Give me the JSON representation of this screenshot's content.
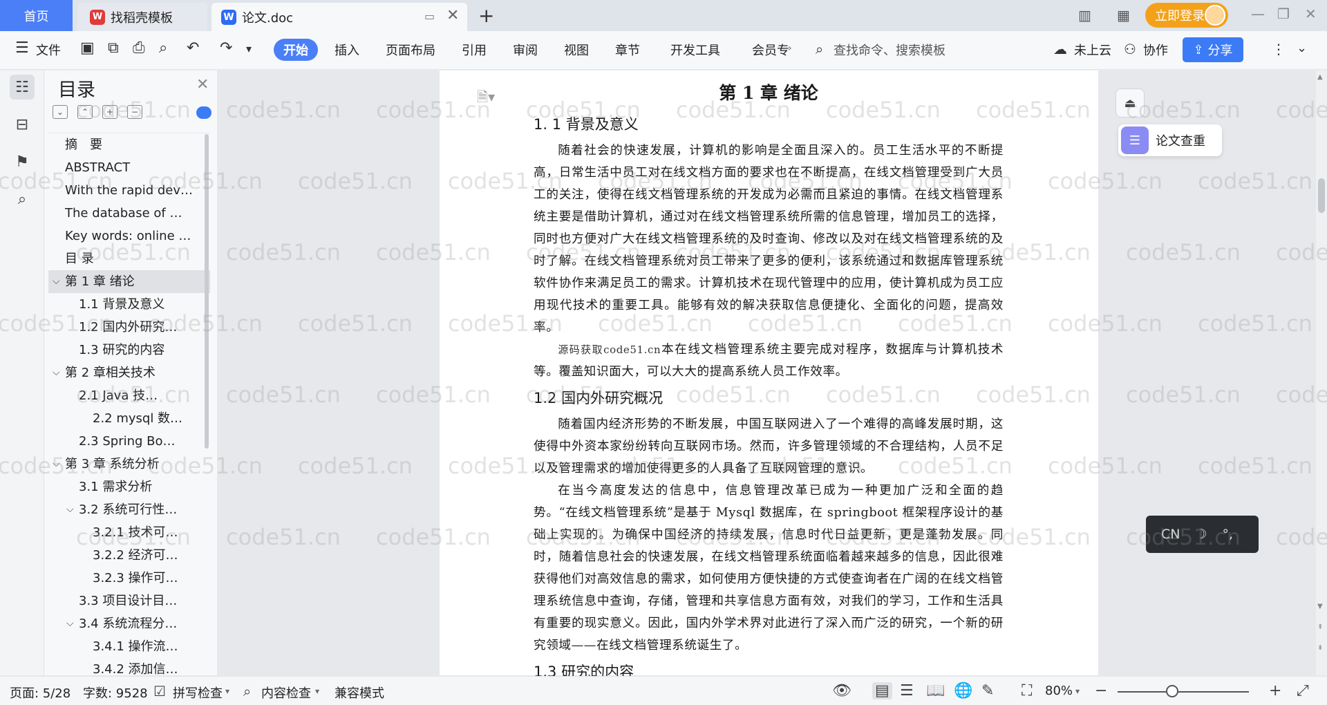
{
  "tabs": {
    "home": "首页",
    "template": "找稻壳模板",
    "document": "论文.doc"
  },
  "titlebar": {
    "login": "立即登录"
  },
  "ribbon": {
    "file": "文件",
    "tabs": [
      "开始",
      "插入",
      "页面布局",
      "引用",
      "审阅",
      "视图",
      "章节",
      "开发工具",
      "会员专"
    ],
    "search_placeholder": "查找命令、搜索模板",
    "cloud": "未上云",
    "collab": "协作",
    "share": "分享"
  },
  "toc": {
    "title": "目录",
    "items": [
      {
        "label": "摘　要",
        "level": 1
      },
      {
        "label": "ABSTRACT",
        "level": 1
      },
      {
        "label": "With the rapid dev…",
        "level": 1
      },
      {
        "label": "The database of …",
        "level": 1
      },
      {
        "label": "Key words: online …",
        "level": 1
      },
      {
        "label": "目  录",
        "level": 1
      },
      {
        "label": "第 1 章  绪论",
        "level": 1
      },
      {
        "label": "1.1 背景及意义",
        "level": 2
      },
      {
        "label": "1.2  国内外研究…",
        "level": 2
      },
      {
        "label": "1.3  研究的内容",
        "level": 2
      },
      {
        "label": "第 2 章相关技术",
        "level": 1
      },
      {
        "label": "2.1    Java 技…",
        "level": 2
      },
      {
        "label": "2.2 mysql 数…",
        "level": 3
      },
      {
        "label": "2.3 Spring    Bo…",
        "level": 2
      },
      {
        "label": "第 3 章  系统分析",
        "level": 1
      },
      {
        "label": "3.1  需求分析",
        "level": 2
      },
      {
        "label": "3.2  系统可行性…",
        "level": 2
      },
      {
        "label": "3.2.1 技术可…",
        "level": 3
      },
      {
        "label": "3.2.2 经济可…",
        "level": 3
      },
      {
        "label": "3.2.3 操作可…",
        "level": 3
      },
      {
        "label": "3.3  项目设计目…",
        "level": 2
      },
      {
        "label": "3.4 系统流程分…",
        "level": 2
      },
      {
        "label": "3.4.1 操作流…",
        "level": 3
      },
      {
        "label": "3.4.2 添加信…",
        "level": 3
      }
    ]
  },
  "document": {
    "chapter_title": "第 1 章  绪论",
    "h_1_1": "1. 1 背景及意义",
    "p1": "随着社会的快速发展，计算机的影响是全面且深入的。员工生活水平的不断提高，日常生活中员工对在线文档方面的要求也在不断提高，在线文档管理受到广大员工的关注，使得在线文档管理系统的开发成为必需而且紧迫的事情。在线文档管理系统主要是借助计算机，通过对在线文档管理系统所需的信息管理，增加员工的选择，同时也方便对广大在线文档管理系统的及时查询、修改以及对在线文档管理系统的及时了解。在线文档管理系统对员工带来了更多的便利，该系统通过和数据库管理系统软件协作来满足员工的需求。计算机技术在现代管理中的应用，使计算机成为员工应用现代技术的重要工具。能够有效的解决获取信息便捷化、全面化的问题，提高效率。",
    "p2_overlay": "源码获取code51.cn",
    "p2": "本在线文档管理系统主要完成对程序，数据库与计算机技术等。覆盖知识面大，可以大大的提高系统人员工作效率。",
    "h_1_2": "1.2  国内外研究概况",
    "p3": "随着国内经济形势的不断发展，中国互联网进入了一个难得的高峰发展时期，这使得中外资本家纷纷转向互联网市场。然而，许多管理领域的不合理结构，人员不足以及管理需求的增加使得更多的人具备了互联网管理的意识。",
    "p4": "在当今高度发达的信息中，信息管理改革已成为一种更加广泛和全面的趋势。“在线文档管理系统”是基于 Mysql 数据库，在 springboot 框架程序设计的基础上实现的。为确保中国经济的持续发展，信息时代日益更新，更是蓬勃发展。同时，随着信息社会的快速发展，在线文档管理系统面临着越来越多的信息，因此很难获得他们对高效信息的需求，如何使用方便快捷的方式使查询者在广阔的在线文档管理系统信息中查询，存储，管理和共享信息方面有效，对我们的学习，工作和生活具有重要的现实意义。因此，国内外学术界对此进行了深入而广泛的研究，一个新的研究领域——在线文档管理系统诞生了。",
    "h_1_3": "1.3  研究的内容"
  },
  "right_panel": {
    "check": "论文查重",
    "ime_lang": "CN",
    "ime_moon": "☽",
    "ime_punct": "°,"
  },
  "watermark": "code51.cn",
  "status": {
    "page": "页面: 5/28",
    "words": "字数: 9528",
    "spell": "拼写检查",
    "content_check": "内容检查",
    "compat": "兼容模式",
    "zoom": "80%"
  }
}
